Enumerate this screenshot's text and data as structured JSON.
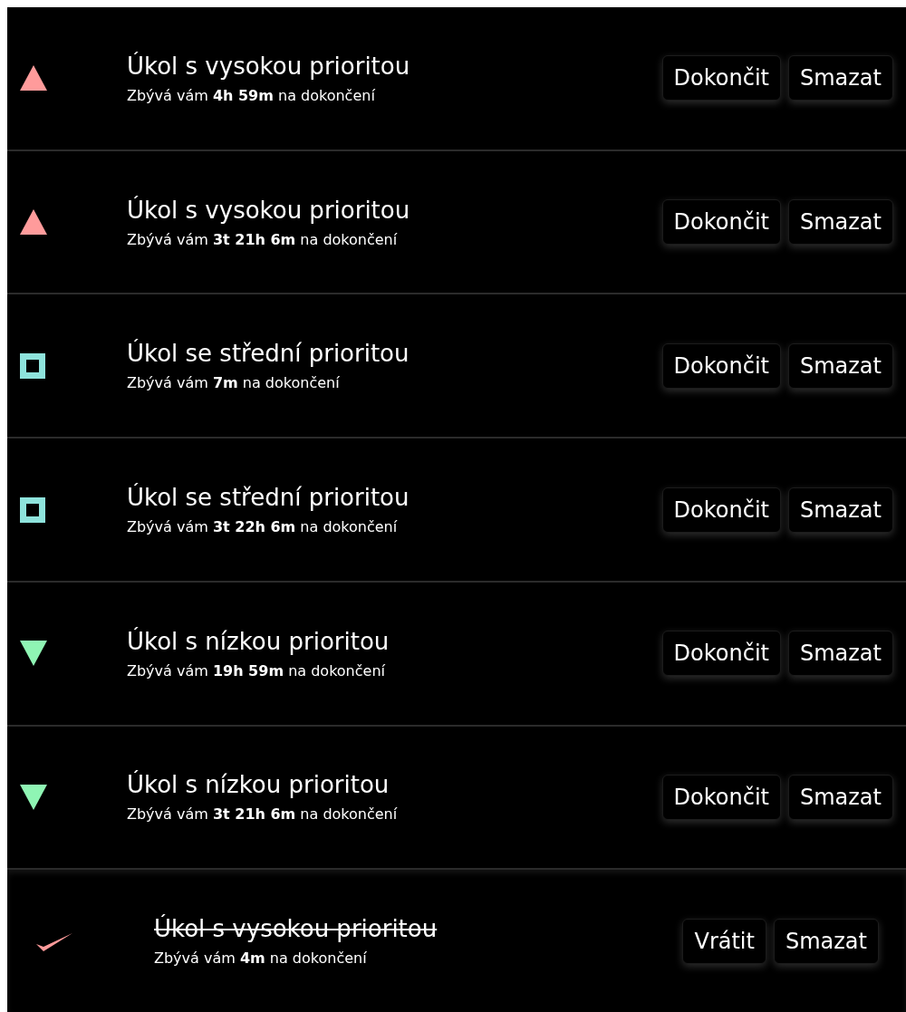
{
  "tasks": [
    {
      "kind": "high",
      "color": "#ff9b9b",
      "done": false,
      "title": "Úkol s vysokou prioritou",
      "remaining": "Zbývá vám **4h 59m** na dokončení",
      "buttons": [
        "Dokončit",
        "Smazat"
      ]
    },
    {
      "kind": "high",
      "color": "#ff9b9b",
      "done": false,
      "title": "Úkol s vysokou prioritou",
      "remaining": "Zbývá vám **3t 21h 6m** na dokončení",
      "buttons": [
        "Dokončit",
        "Smazat"
      ]
    },
    {
      "kind": "medium",
      "color": "#8ee3dc",
      "done": false,
      "title": "Úkol se střední prioritou",
      "remaining": "Zbývá vám **7m** na dokončení",
      "buttons": [
        "Dokončit",
        "Smazat"
      ]
    },
    {
      "kind": "medium",
      "color": "#8ee3dc",
      "done": false,
      "title": "Úkol se střední prioritou",
      "remaining": "Zbývá vám **3t 22h 6m** na dokončení",
      "buttons": [
        "Dokončit",
        "Smazat"
      ]
    },
    {
      "kind": "low",
      "color": "#8ff5b4",
      "done": false,
      "title": "Úkol s nízkou prioritou",
      "remaining": "Zbývá vám **19h 59m** na dokončení",
      "buttons": [
        "Dokončit",
        "Smazat"
      ]
    },
    {
      "kind": "low",
      "color": "#8ff5b4",
      "done": false,
      "title": "Úkol s nízkou prioritou",
      "remaining": "Zbývá vám **3t 21h 6m** na dokončení",
      "buttons": [
        "Dokončit",
        "Smazat"
      ]
    },
    {
      "color": "#ff9b9b",
      "done": true,
      "title": "Úkol s vysokou prioritou",
      "remaining": "Zbývá vám **4m** na dokončení",
      "buttons": [
        "Vrátit",
        "Smazat"
      ]
    }
  ]
}
